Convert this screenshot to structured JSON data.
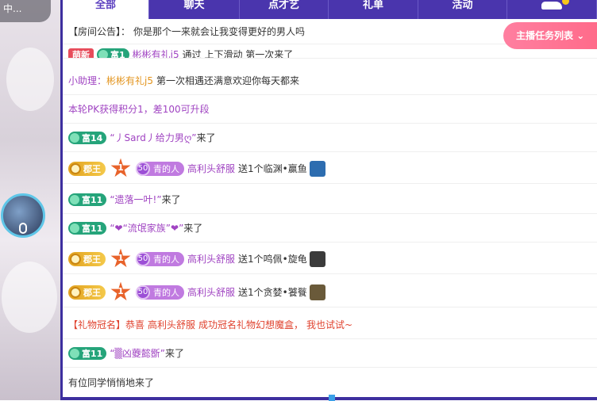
{
  "stream": {
    "status_text": "中..."
  },
  "tabs": [
    {
      "label": "全部",
      "active": true
    },
    {
      "label": "聊天",
      "active": false
    },
    {
      "label": "点才艺",
      "active": false
    },
    {
      "label": "礼单",
      "active": false
    },
    {
      "label": "活动",
      "active": false
    },
    {
      "label": "",
      "active": false,
      "icon": "car-icon"
    }
  ],
  "task_button": "主播任务列表",
  "chat": {
    "announcement": {
      "prefix": "【房间公告】：",
      "text": "你是那个一来就会让我变得更好的男人吗"
    },
    "partial_row": {
      "medal": "萌新",
      "rich": "富1",
      "user": "彬彬有礼j5",
      "text": "通过 上下滑动 第一次来了"
    },
    "assistant": {
      "label": "小助理：",
      "user": "彬彬有礼j5",
      "text": "第一次相遇还满意欢迎你每天都来"
    },
    "pk": "本轮PK获得积分1，差100可升段",
    "rows": [
      {
        "type": "enter",
        "rich": "富14",
        "user": "“丿Sard丿给力男ღ”",
        "suffix": "来了"
      },
      {
        "type": "gift",
        "lord": "郡王",
        "rank": "1",
        "fan_level": "50",
        "fan_name": "青的人",
        "user": "高利头舒服",
        "text": "送1个临渊•赢鱼",
        "gift_color": "#2d6db0"
      },
      {
        "type": "enter",
        "rich": "富11",
        "user": "“遗落一叶!”",
        "suffix": "来了"
      },
      {
        "type": "enter",
        "rich": "富11",
        "user": "“❤“流氓家族”❤”",
        "suffix": "来了"
      },
      {
        "type": "gift",
        "lord": "郡王",
        "rank": "1",
        "fan_level": "50",
        "fan_name": "青的人",
        "user": "高利头舒服",
        "text": "送1个鸣佩•旋龟",
        "gift_color": "#3b3b3b"
      },
      {
        "type": "gift",
        "lord": "郡王",
        "rank": "1",
        "fan_level": "50",
        "fan_name": "青的人",
        "user": "高利头舒服",
        "text": "送1个贪婪•饕餮",
        "gift_color": "#6a5a3a"
      }
    ],
    "gift_crown": {
      "prefix": "【礼物冠名】恭喜",
      "user": "高利头舒服",
      "text": "成功冠名礼物幻想魔盒，",
      "cta": "我也试试~"
    },
    "last_enter": {
      "rich": "富11",
      "user": "“▒凶蘷懿斵”",
      "suffix": "来了"
    },
    "quiet": "有位同学悄悄地来了"
  },
  "colors": {
    "tab_bar": "#4a35ad",
    "rich_medal": "#25a47a",
    "lord_medal": "#e2a21f",
    "task_button": "#ff6b8a"
  }
}
